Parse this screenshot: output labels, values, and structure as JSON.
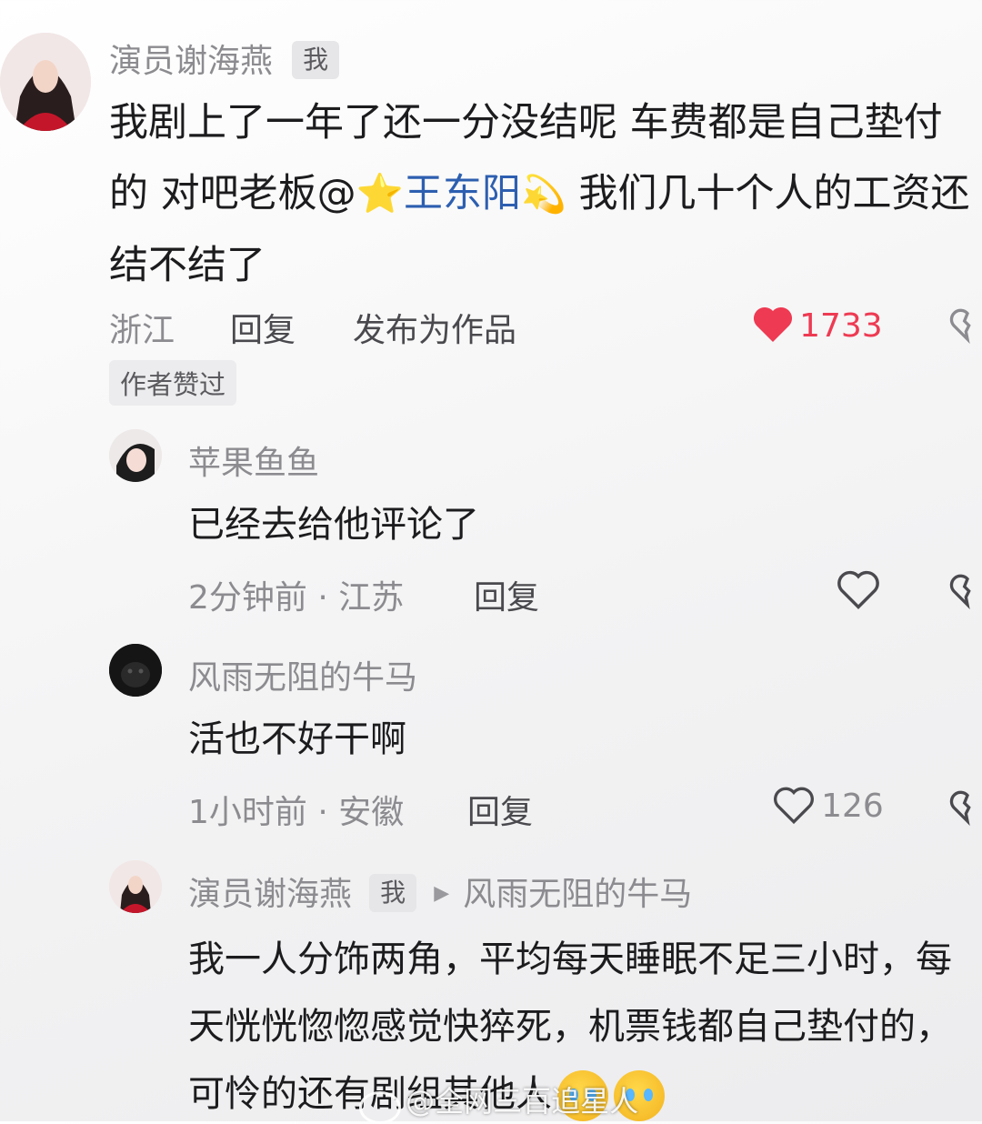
{
  "comment_main": {
    "author": "演员谢海燕",
    "author_tag": "我",
    "text_before_mention": "我剧上了一年了还一分没结呢 车费都是自己垫付的 对吧老板@",
    "mention_name": "王东阳",
    "text_after_mention": " 我们几十个人的工资还结不结了",
    "location": "浙江",
    "reply_label": "回复",
    "publish_label": "发布为作品",
    "like_count": "1733",
    "author_liked_label": "作者赞过"
  },
  "replies": [
    {
      "author": "苹果鱼鱼",
      "text": "已经去给他评论了",
      "meta": "2分钟前 · 江苏",
      "reply_label": "回复"
    },
    {
      "author": "风雨无阻的牛马",
      "text": "活也不好干啊",
      "meta": "1小时前 · 安徽",
      "reply_label": "回复",
      "like_count": "126"
    },
    {
      "author": "演员谢海燕",
      "author_tag": "我",
      "reply_to": "风雨无阻的牛马",
      "text": "我一人分饰两角，平均每天睡眠不足三小时，每天恍恍惚惚感觉快猝死，机票钱都自己垫付的，可怜的还有剧组其他人"
    }
  ],
  "watermark": "@全网三百追星人",
  "colors": {
    "like_red": "#ee3a52",
    "mention_blue": "#2d5fb0",
    "meta_gray": "#8c8c90"
  },
  "icons": [
    "heart-filled-icon",
    "heart-outline-icon",
    "dislike-broken-heart-icon",
    "sparkle-star-emoji",
    "shooting-star-emoji",
    "crying-face-emoji",
    "reply-arrow-icon"
  ]
}
